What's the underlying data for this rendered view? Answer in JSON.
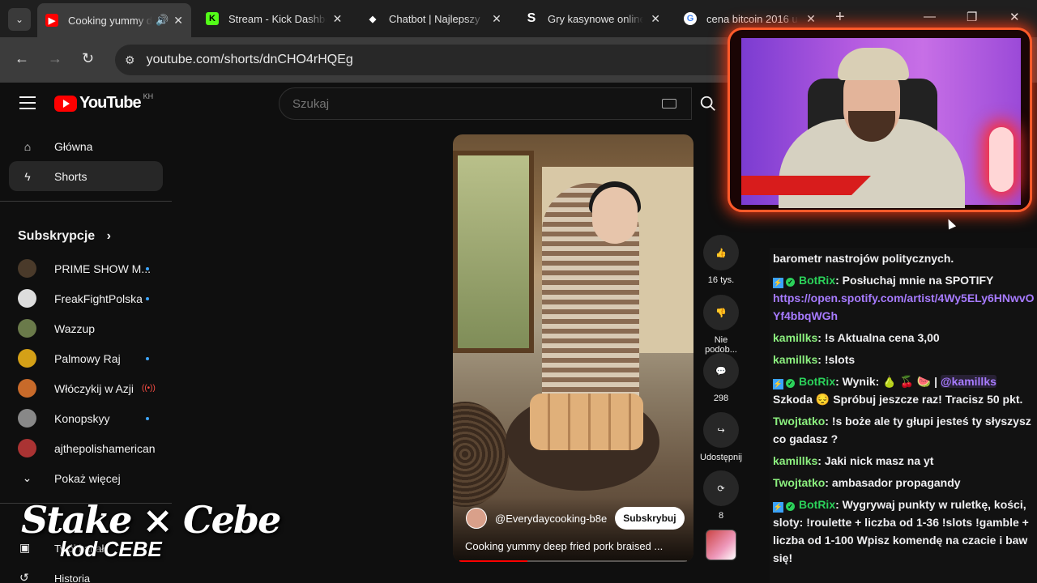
{
  "browser": {
    "tabs": [
      {
        "title": "Cooking yummy deep fried pork",
        "icon": "youtube-icon",
        "color": "#ff0000",
        "active": true
      },
      {
        "title": "Stream - Kick Dashboard",
        "icon": "kick-icon",
        "color": "#53fc18"
      },
      {
        "title": "Chatbot | Najlepszy",
        "icon": "chatbot-icon",
        "color": "#ffffff"
      },
      {
        "title": "Gry kasynowe online",
        "icon": "stake-s-icon",
        "color": "#ffffff"
      },
      {
        "title": "cena bitcoin 2016 u",
        "icon": "google-icon",
        "color": "#4285f4"
      }
    ],
    "url": "youtube.com/shorts/dnCHO4rHQEg"
  },
  "youtube": {
    "logo_text": "YouTube",
    "country_code": "KH",
    "search_placeholder": "Szukaj",
    "nav": [
      {
        "label": "Główna",
        "icon": "home-icon"
      },
      {
        "label": "Shorts",
        "icon": "shorts-icon",
        "active": true
      }
    ],
    "subscriptions_title": "Subskrypcje",
    "subscriptions": [
      {
        "name": "PRIME SHOW M...",
        "indicator": "dot",
        "color": "#4a3a2a"
      },
      {
        "name": "FreakFightPolska",
        "indicator": "dot",
        "color": "#ddd"
      },
      {
        "name": "Wazzup",
        "indicator": "none",
        "color": "#6a7a4a"
      },
      {
        "name": "Palmowy Raj",
        "indicator": "dot",
        "color": "#d4a017"
      },
      {
        "name": "Włóczykij w Azji",
        "indicator": "live",
        "color": "#c86a2a"
      },
      {
        "name": "Konopskyy",
        "indicator": "dot",
        "color": "#888"
      },
      {
        "name": "ajthepolishamerican",
        "indicator": "none",
        "color": "#a33"
      }
    ],
    "show_more": "Pokaż więcej",
    "you_partial": "T",
    "your_channel": "Twój kanał",
    "history": "Historia",
    "short": {
      "channel": "@Everydaycooking-b8e",
      "subscribe": "Subskrybuj",
      "title": "Cooking yummy deep fried pork braised ...",
      "progress": 0.3,
      "likes": "16 tys.",
      "dislike": "Nie podob...",
      "comments": "298",
      "share": "Udostępnij",
      "remix": "8"
    }
  },
  "overlay": {
    "stake_line1": "Stake × Cebe",
    "stake_line2": "kod CEBE"
  },
  "chat": {
    "messages": [
      {
        "text_before": "",
        "user": "",
        "text": "barometr nastrojów politycznych."
      },
      {
        "user": "BotRix",
        "bot": true,
        "text": ": Posłuchaj mnie na SPOTIFY",
        "link": "https://open.spotify.com/artist/4Wy5ELy6HNwvOYf4bbqWGh"
      },
      {
        "user": "kamillks",
        "text": ": !s Aktualna cena 3,00"
      },
      {
        "user": "kamillks",
        "text": ": !slots"
      },
      {
        "user": "BotRix",
        "bot": true,
        "text": ": Wynik: 🍐 🍒 🍉 |",
        "mention": "@kamillks",
        "text2": "Szkoda 😔 Spróbuj jeszcze raz! Tracisz 50 pkt."
      },
      {
        "user": "Twojtatko",
        "text": ": !s boże ale ty głupi jesteś ty słyszysz co gadasz ?"
      },
      {
        "user": "kamillks",
        "text": ": Jaki nick masz na yt"
      },
      {
        "user": "Twojtatko",
        "text": ": ambasador propagandy"
      },
      {
        "user": "BotRix",
        "bot": true,
        "text": ": Wygrywaj punkty w ruletkę, kości, sloty: !roulette + liczba od 1-36 !slots !gamble + liczba od 1-100 Wpisz komendę na czacie i baw się!"
      }
    ]
  }
}
